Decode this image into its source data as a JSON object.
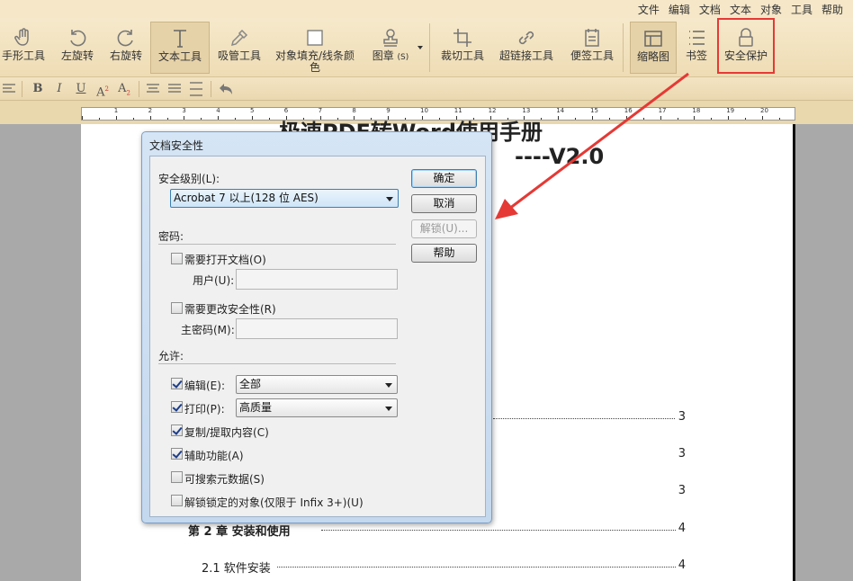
{
  "menu": [
    "文件",
    "编辑",
    "文档",
    "文本",
    "对象",
    "工具",
    "帮助"
  ],
  "toolbar": {
    "hand": "手形工具",
    "rotate_left": "左旋转",
    "rotate_right": "右旋转",
    "text_tool": "文本工具",
    "eyedropper": "吸管工具",
    "fill_stroke": "对象填充/线条颜色",
    "stamp": "图章",
    "stamp_suffix": "(S)",
    "crop": "裁切工具",
    "hyperlink": "超链接工具",
    "note": "便签工具",
    "thumbnail": "缩略图",
    "bookmark": "书签",
    "security": "安全保护"
  },
  "format": {
    "bold": "B",
    "italic": "I",
    "underline": "U",
    "superscript": "A",
    "subscript": "A"
  },
  "ruler": [
    "1",
    "2",
    "3",
    "4",
    "5",
    "6",
    "7",
    "8",
    "9",
    "10",
    "11",
    "12",
    "13",
    "14",
    "15",
    "16",
    "17",
    "18",
    "19",
    "20"
  ],
  "document": {
    "title_line1": "极速PDF转Word使用手册",
    "title_line2": "----V2.0",
    "toc": [
      {
        "text": "第 2 章   安装和使用",
        "page": "4"
      },
      {
        "text": "2.1 软件安装",
        "page": "4"
      }
    ],
    "toc_pages_partial": [
      "3",
      "3",
      "3"
    ]
  },
  "dialog": {
    "title": "文档安全性",
    "security_level_label": "安全级别(L):",
    "security_level_value": "Acrobat 7 以上(128 位 AES)",
    "password_section": "密码:",
    "require_open": "需要打开文档(O)",
    "user_label": "用户(U):",
    "require_change": "需要更改安全性(R)",
    "master_label": "主密码(M):",
    "permit_section": "允许:",
    "edit_label": "编辑(E):",
    "edit_value": "全部",
    "print_label": "打印(P):",
    "print_value": "高质量",
    "copy": "复制/提取内容(C)",
    "accessibility": "辅助功能(A)",
    "searchable": "可搜索元数据(S)",
    "unlock_objects": "解锁锁定的对象(仅限于 Infix 3+)(U)",
    "ok": "确定",
    "cancel": "取消",
    "unlock": "解锁(U)...",
    "help": "帮助"
  },
  "colors": {
    "annotation": "#e53935",
    "toolbar_bg": "#f0e0bc",
    "dialog_frame": "#c9dcf0"
  }
}
